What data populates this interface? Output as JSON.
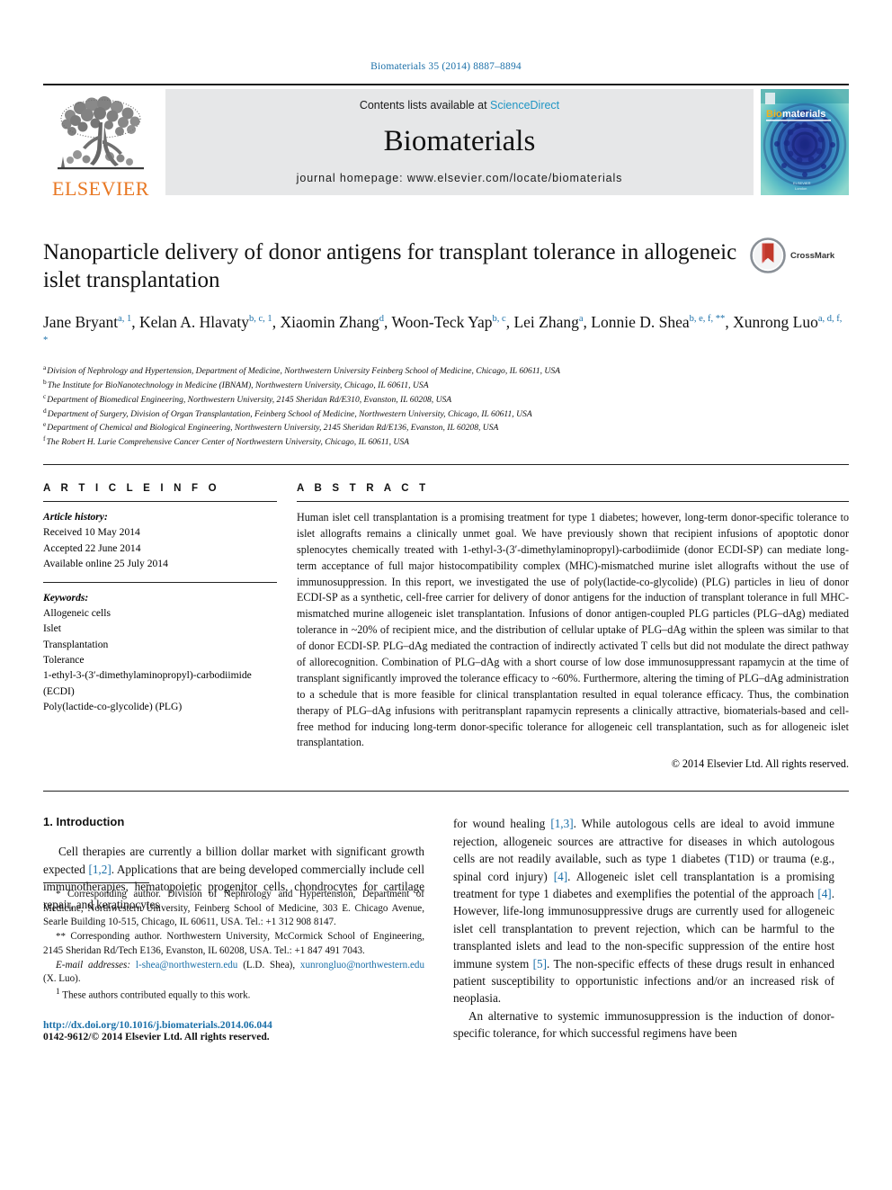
{
  "running_head": "Biomaterials 35 (2014) 8887–8894",
  "masthead": {
    "contents_prefix": "Contents lists available at ",
    "sciencedirect": "ScienceDirect",
    "journal_name": "Biomaterials",
    "homepage": "journal homepage: www.elsevier.com/locate/biomaterials",
    "publisher_wordmark": "ELSEVIER",
    "cover_title_bio": "Bio",
    "cover_title_materials": "materials",
    "accent_orange": "#E87722",
    "accent_blue": "#1a6fa8",
    "link_blue": "#2196c4"
  },
  "article": {
    "title": "Nanoparticle delivery of donor antigens for transplant tolerance in allogeneic islet transplantation",
    "crossmark_label": "CrossMark",
    "authors": [
      {
        "name": "Jane Bryant",
        "marks": "a, 1",
        "sep": ", "
      },
      {
        "name": "Kelan A. Hlavaty",
        "marks": "b, c, 1",
        "sep": ", "
      },
      {
        "name": "Xiaomin Zhang",
        "marks": "d",
        "sep": ", "
      },
      {
        "name": "Woon-Teck Yap",
        "marks": "b, c",
        "sep": ", "
      },
      {
        "name": "Lei Zhang",
        "marks": "a",
        "sep": ", "
      },
      {
        "name": "Lonnie D. Shea",
        "marks": "b, e, f, **",
        "sep": ", "
      },
      {
        "name": "Xunrong Luo",
        "marks": "a, d, f, *",
        "sep": ""
      }
    ],
    "affiliations": [
      {
        "mark": "a",
        "text": "Division of Nephrology and Hypertension, Department of Medicine, Northwestern University Feinberg School of Medicine, Chicago, IL 60611, USA"
      },
      {
        "mark": "b",
        "text": "The Institute for BioNanotechnology in Medicine (IBNAM), Northwestern University, Chicago, IL 60611, USA"
      },
      {
        "mark": "c",
        "text": "Department of Biomedical Engineering, Northwestern University, 2145 Sheridan Rd/E310, Evanston, IL 60208, USA"
      },
      {
        "mark": "d",
        "text": "Department of Surgery, Division of Organ Transplantation, Feinberg School of Medicine, Northwestern University, Chicago, IL 60611, USA"
      },
      {
        "mark": "e",
        "text": "Department of Chemical and Biological Engineering, Northwestern University, 2145 Sheridan Rd/E136, Evanston, IL 60208, USA"
      },
      {
        "mark": "f",
        "text": "The Robert H. Lurie Comprehensive Cancer Center of Northwestern University, Chicago, IL 60611, USA"
      }
    ]
  },
  "article_info": {
    "heading": "A R T I C L E   I N F O",
    "history_label": "Article history:",
    "history": [
      "Received 10 May 2014",
      "Accepted 22 June 2014",
      "Available online 25 July 2014"
    ],
    "keywords_label": "Keywords:",
    "keywords": [
      "Allogeneic cells",
      "Islet",
      "Transplantation",
      "Tolerance",
      "1-ethyl-3-(3′-dimethylaminopropyl)-carbodiimide (ECDI)",
      "Poly(lactide-co-glycolide) (PLG)"
    ]
  },
  "abstract": {
    "heading": "A B S T R A C T",
    "text": "Human islet cell transplantation is a promising treatment for type 1 diabetes; however, long-term donor-specific tolerance to islet allografts remains a clinically unmet goal. We have previously shown that recipient infusions of apoptotic donor splenocytes chemically treated with 1-ethyl-3-(3′-dimethylaminopropyl)-carbodiimide (donor ECDI-SP) can mediate long-term acceptance of full major histocompatibility complex (MHC)-mismatched murine islet allografts without the use of immunosuppression. In this report, we investigated the use of poly(lactide-co-glycolide) (PLG) particles in lieu of donor ECDI-SP as a synthetic, cell-free carrier for delivery of donor antigens for the induction of transplant tolerance in full MHC-mismatched murine allogeneic islet transplantation. Infusions of donor antigen-coupled PLG particles (PLG–dAg) mediated tolerance in ~20% of recipient mice, and the distribution of cellular uptake of PLG–dAg within the spleen was similar to that of donor ECDI-SP. PLG–dAg mediated the contraction of indirectly activated T cells but did not modulate the direct pathway of allorecognition. Combination of PLG–dAg with a short course of low dose immunosuppressant rapamycin at the time of transplant significantly improved the tolerance efficacy to ~60%. Furthermore, altering the timing of PLG–dAg administration to a schedule that is more feasible for clinical transplantation resulted in equal tolerance efficacy. Thus, the combination therapy of PLG–dAg infusions with peritransplant rapamycin represents a clinically attractive, biomaterials-based and cell-free method for inducing long-term donor-specific tolerance for allogeneic cell transplantation, such as for allogeneic islet transplantation.",
    "copyright": "© 2014 Elsevier Ltd. All rights reserved."
  },
  "introduction": {
    "heading": "1. Introduction",
    "left_para_1_a": "Cell therapies are currently a billion dollar market with significant growth expected ",
    "left_para_1_ref1": "[1,2]",
    "left_para_1_b": ". Applications that are being developed commercially include cell immunotherapies, hematopoietic progenitor cells, chondrocytes for cartilage repair, and keratinocytes",
    "right_para_1_a": "for wound healing ",
    "right_para_1_ref1": "[1,3]",
    "right_para_1_b": ". While autologous cells are ideal to avoid immune rejection, allogeneic sources are attractive for diseases in which autologous cells are not readily available, such as type 1 diabetes (T1D) or trauma (e.g., spinal cord injury) ",
    "right_para_1_ref2": "[4]",
    "right_para_1_c": ". Allogeneic islet cell transplantation is a promising treatment for type 1 diabetes and exemplifies the potential of the approach ",
    "right_para_1_ref3": "[4]",
    "right_para_1_d": ". However, life-long immunosuppressive drugs are currently used for allogeneic islet cell transplantation to prevent rejection, which can be harmful to the transplanted islets and lead to the non-specific suppression of the entire host immune system ",
    "right_para_1_ref4": "[5]",
    "right_para_1_e": ". The non-specific effects of these drugs result in enhanced patient susceptibility to opportunistic infections and/or an increased risk of neoplasia.",
    "right_para_2": "An alternative to systemic immunosuppression is the induction of donor-specific tolerance, for which successful regimens have been"
  },
  "footnotes": {
    "corr1_mark": "*",
    "corr1": " Corresponding author. Division of Nephrology and Hypertension, Department of Medicine, Northwestern University, Feinberg School of Medicine, 303 E. Chicago Avenue, Searle Building 10-515, Chicago, IL 60611, USA. Tel.: +1 312 908 8147.",
    "corr2_mark": "**",
    "corr2": " Corresponding author. Northwestern University, McCormick School of Engineering, 2145 Sheridan Rd/Tech E136, Evanston, IL 60208, USA. Tel.: +1 847 491 7043.",
    "email_label": "E-mail addresses:",
    "email1": "l-shea@northwestern.edu",
    "email1_who": "(L.D. Shea)",
    "email2": "xunrongluo@northwestern.edu",
    "email2_who": "(X. Luo)",
    "equal_mark": "1",
    "equal_contrib": " These authors contributed equally to this work.",
    "doi": "http://dx.doi.org/10.1016/j.biomaterials.2014.06.044",
    "issn_line": "0142-9612/© 2014 Elsevier Ltd. All rights reserved."
  }
}
